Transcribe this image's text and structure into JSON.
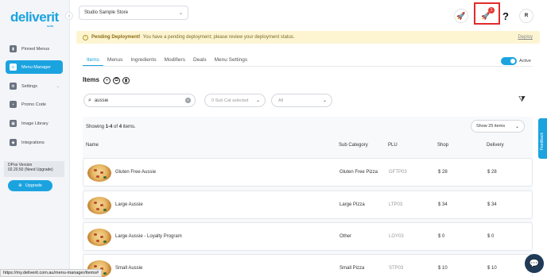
{
  "brand": {
    "logo_text": "deliverit",
    "logo_sub": "solo"
  },
  "sidebar": {
    "collapse_icon": "chevron-left-icon",
    "items": [
      {
        "label": "Pinned Menus",
        "icon": "pin-icon"
      },
      {
        "label": "Menu Manager",
        "icon": "menu-icon",
        "active": true
      },
      {
        "label": "Settings",
        "icon": "gear-icon",
        "has_caret": true
      },
      {
        "label": "Promo Code",
        "icon": "ticket-icon"
      },
      {
        "label": "Image Library",
        "icon": "image-icon"
      },
      {
        "label": "Integrations",
        "icon": "plug-icon"
      }
    ],
    "version_label": "DPos Version",
    "version_value": "02.20.50 (Need Upgrade)",
    "upgrade_label": "Upgrade"
  },
  "header": {
    "store_select": "Studio Sample Store",
    "notification_count": "1",
    "help_glyph": "?",
    "avatar_initial": "R"
  },
  "banner": {
    "title": "Pending Deployment!",
    "message": "You have a pending deployment; please review your deployment status.",
    "action": "Deploy"
  },
  "tabs": [
    "Items",
    "Menus",
    "Ingredients",
    "Modifiers",
    "Deals",
    "Menu Settings"
  ],
  "active_toggle": {
    "label": "Active",
    "on": true
  },
  "items_section": {
    "title": "Items"
  },
  "filters": {
    "search_value": "aussie",
    "subcat_placeholder": "0 Sub Cat selected",
    "status_value": "All"
  },
  "table": {
    "showing_prefix": "Showing ",
    "showing_range": "1-4",
    "showing_mid": " of ",
    "showing_total": "4",
    "showing_suffix": " items.",
    "page_size": "Show 25 items",
    "columns": [
      "Name",
      "Sub Category",
      "PLU",
      "Shop",
      "Delivery"
    ],
    "rows": [
      {
        "name": "Gluten Free Aussie",
        "sub_category": "Gluten Free Pizza",
        "plu": "GFTP03",
        "shop": "$ 28",
        "delivery": "$ 28"
      },
      {
        "name": "Large Aussie",
        "sub_category": "Large Pizza",
        "plu": "LTP03",
        "shop": "$ 34",
        "delivery": "$ 34"
      },
      {
        "name": "Large Aussie - Loyalty Program",
        "sub_category": "Other",
        "plu": "LOY03",
        "shop": "$ 0",
        "delivery": "$ 0"
      },
      {
        "name": "Small Aussie",
        "sub_category": "Small Pizza",
        "plu": "STP03",
        "shop": "$ 10",
        "delivery": "$ 10"
      }
    ]
  },
  "feedback_label": "Feedback",
  "status_bar_url": "https://my.deliverit.com.au/menu-manager/items#",
  "colors": {
    "brand": "#1ba3e0",
    "alert_bg": "#fdf5d2",
    "highlight_box": "#e12b2b"
  }
}
